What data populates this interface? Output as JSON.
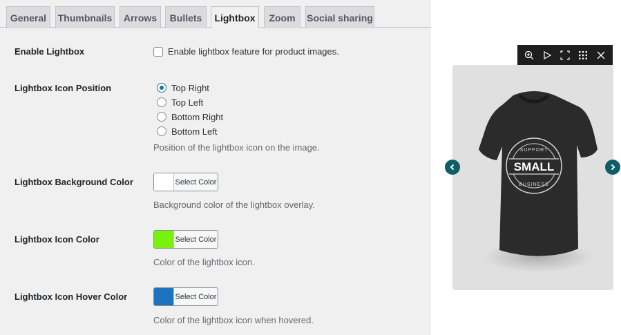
{
  "tabs": [
    "General",
    "Thumbnails",
    "Arrows",
    "Bullets",
    "Lightbox",
    "Zoom",
    "Social sharing"
  ],
  "active_tab": "Lightbox",
  "enable_lightbox": {
    "label": "Enable Lightbox",
    "checkbox_label": "Enable lightbox feature for product images.",
    "checked": false
  },
  "icon_position": {
    "label": "Lightbox Icon Position",
    "options": [
      "Top Right",
      "Top Left",
      "Bottom Right",
      "Bottom Left"
    ],
    "selected": "Top Right",
    "description": "Position of the lightbox icon on the image."
  },
  "background_color": {
    "label": "Lightbox Background Color",
    "button_label": "Select Color",
    "color": "#ffffff",
    "description": "Background color of the lightbox overlay."
  },
  "icon_color": {
    "label": "Lightbox Icon Color",
    "button_label": "Select Color",
    "color": "#77f20f",
    "description": "Color of the lightbox icon."
  },
  "hover_color": {
    "label": "Lightbox Icon Hover Color",
    "button_label": "Select Color",
    "color": "#1e73be",
    "description": "Color of the lightbox icon when hovered."
  },
  "preview": {
    "toolbar_icons": [
      "zoom-in-icon",
      "play-icon",
      "fullscreen-icon",
      "grid-icon",
      "close-icon"
    ],
    "shirt_text": {
      "main": "SMALL",
      "top": "SUPPORT",
      "bottom": "BUSINESS"
    },
    "colors": {
      "card": "#e0e0e0",
      "toolbar": "#1e1e1e",
      "arrow": "#0f5d66",
      "shirt": "#2b2b2b"
    }
  }
}
